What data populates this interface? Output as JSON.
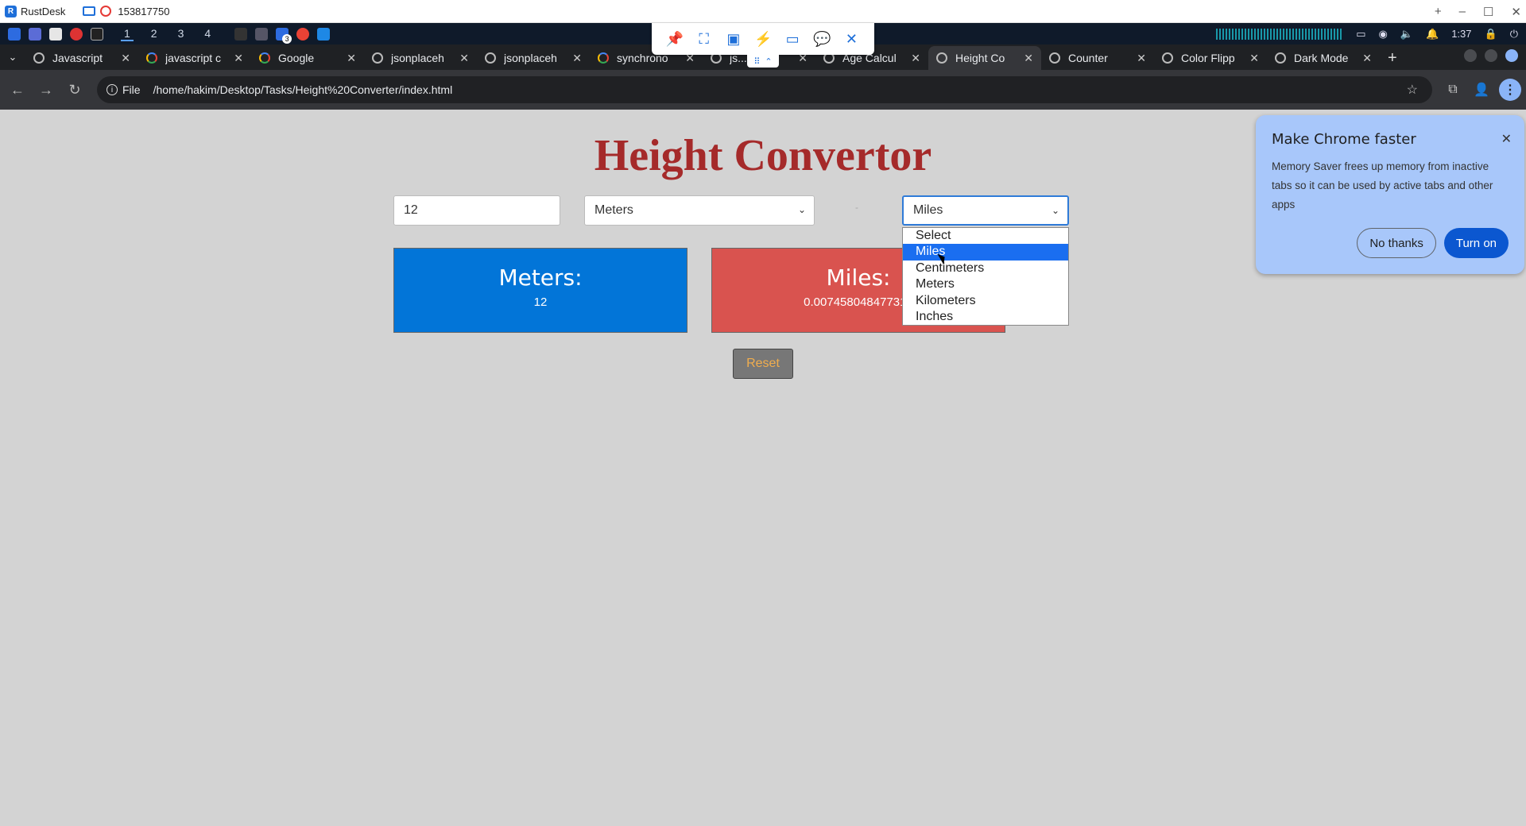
{
  "rustdesk": {
    "app_name": "RustDesk",
    "session_id": "153817750"
  },
  "taskbar": {
    "workspaces": [
      "1",
      "2",
      "3",
      "4"
    ],
    "badge": "3",
    "time": "1:37"
  },
  "tabs": [
    {
      "title": "Javascript",
      "active": false
    },
    {
      "title": "javascript c",
      "active": false
    },
    {
      "title": "Google",
      "active": false
    },
    {
      "title": "jsonplaceh",
      "active": false
    },
    {
      "title": "jsonplaceh",
      "active": false
    },
    {
      "title": "synchrono",
      "active": false
    },
    {
      "title": "js...",
      "active": false
    },
    {
      "title": "Age Calcul",
      "active": false
    },
    {
      "title": "Height Co",
      "active": true
    },
    {
      "title": "Counter",
      "active": false
    },
    {
      "title": "Color Flipp",
      "active": false
    },
    {
      "title": "Dark Mode",
      "active": false
    }
  ],
  "omnibox": {
    "scheme_label": "File",
    "url": "/home/hakim/Desktop/Tasks/Height%20Converter/index.html"
  },
  "page": {
    "title": "Height Convertor",
    "amount": "12",
    "from_unit": "Meters",
    "to_unit": "Miles",
    "from_card": {
      "label": "Meters:",
      "value": "12"
    },
    "to_card": {
      "label": "Miles:",
      "value": "0.007458048477315"
    },
    "reset_label": "Reset",
    "dropdown_options": [
      "Select",
      "Miles",
      "Centimeters",
      "Meters",
      "Kilometers",
      "Inches"
    ],
    "dropdown_selected": "Miles"
  },
  "promo": {
    "title": "Make Chrome faster",
    "body": "Memory Saver frees up memory from inactive tabs so it can be used by active tabs and other apps",
    "decline_label": "No thanks",
    "accept_label": "Turn on"
  },
  "colors": {
    "title": "#a52a2a",
    "from_card": "#0275d8",
    "to_card": "#d9534f",
    "reset_text": "#f0ad4e",
    "selected_option": "#1a6ef0",
    "promo_bg": "#a8c7fa"
  }
}
